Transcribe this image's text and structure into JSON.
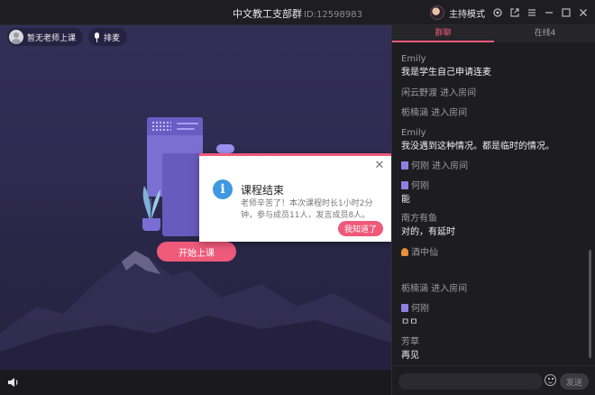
{
  "window": {
    "title": "中文教工支部群",
    "room_id": "ID:12598983",
    "host_mode_label": "主持模式",
    "icons": [
      "settings-icon",
      "popout-icon",
      "menu-icon",
      "minimize-icon",
      "maximize-icon",
      "close-icon"
    ]
  },
  "stage": {
    "teacher_label": "暂无老师上课",
    "queue_label": "排麦",
    "start_button": "开始上课"
  },
  "dialog": {
    "title": "课程结束",
    "body": "老师辛苦了！本次课程时长1小时2分钟，参与成员11人，发言成员8人。",
    "ok_button": "我知道了",
    "accent": "#ef5a7a"
  },
  "side": {
    "tabs": [
      "群聊",
      "在线4"
    ],
    "messages": [
      {
        "name": "Emily",
        "text": "我是学生自己申请连麦"
      },
      {
        "system": "闲云野渡 进入房间"
      },
      {
        "system": "栀楠涵 进入房间"
      },
      {
        "name": "Emily",
        "text": "我没遇到这种情况。都是临时的情况。"
      },
      {
        "system": "何刚 进入房间"
      },
      {
        "name": "何刚",
        "text": "能"
      },
      {
        "name": "南方有鱼",
        "text": "对的，有延时"
      },
      {
        "name": "酒中仙",
        "text": ""
      },
      {
        "system": "栀楠涵 进入房间"
      },
      {
        "name": "何刚",
        "text": "ㅁㅁ"
      },
      {
        "name": "芳草",
        "text": "再见"
      }
    ],
    "input_placeholder": "",
    "send_label": "发送"
  }
}
